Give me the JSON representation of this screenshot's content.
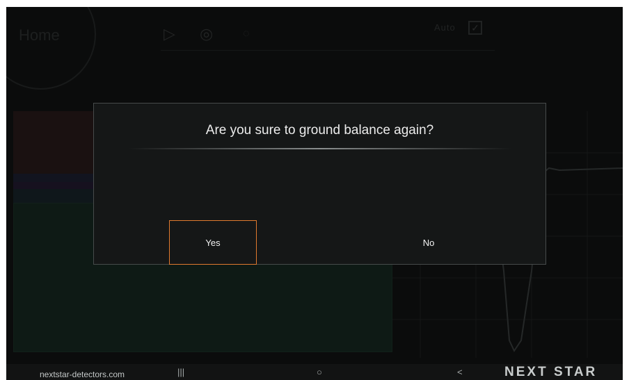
{
  "background_app": {
    "home_title": "Home",
    "auto_label": "Auto",
    "auto_checked": true
  },
  "dialog": {
    "title": "Are you sure to ground balance again?",
    "yes_label": "Yes",
    "no_label": "No",
    "focused_button": "Yes",
    "focus_color": "#e07a2f"
  },
  "navbar": {
    "site_url": "nextstar-detectors.com",
    "recents_glyph": "|||",
    "home_glyph": "○",
    "back_glyph": "<",
    "brand": "NEXT STAR"
  },
  "colors": {
    "screen_bg": "#121313",
    "dialog_bg": "#151717",
    "dialog_border": "#474b4b",
    "text": "#ececec"
  }
}
